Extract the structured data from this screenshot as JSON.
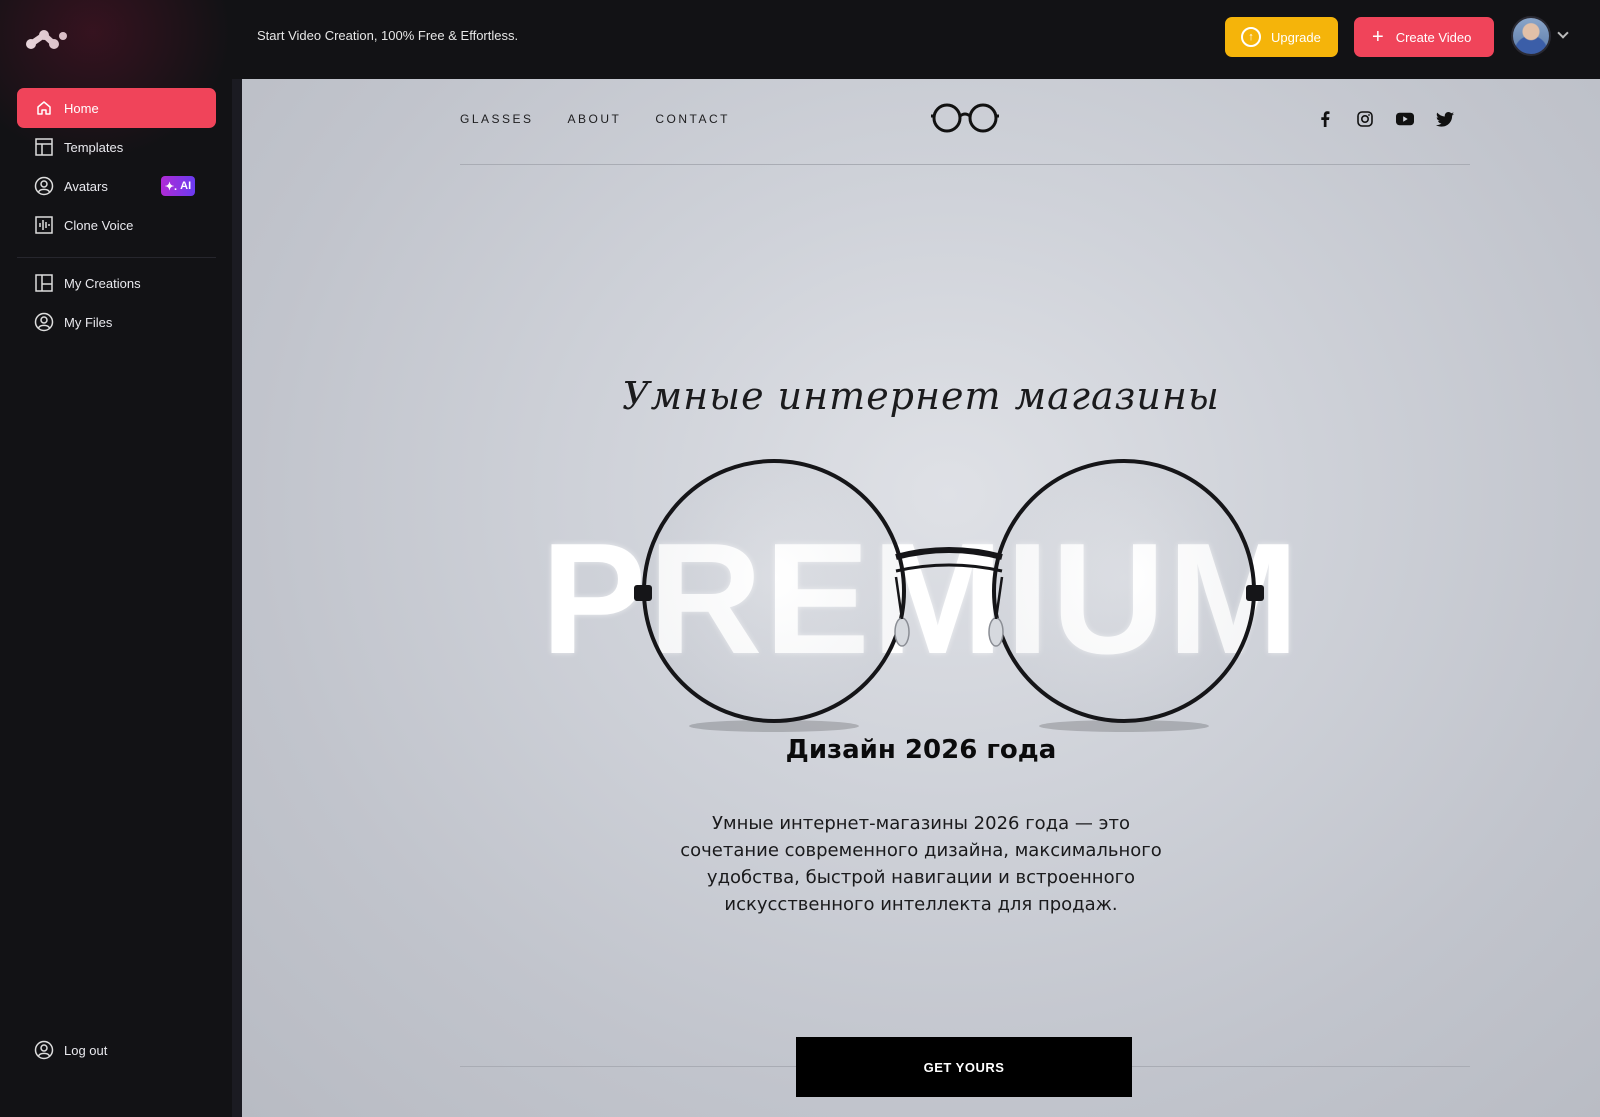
{
  "app": {
    "tagline": "Start Video Creation, 100% Free & Effortless.",
    "upgrade_label": "Upgrade",
    "create_label": "Create Video",
    "accent_color": "#f0445a",
    "upgrade_color": "#f5b40a"
  },
  "sidebar": {
    "items": [
      {
        "label": "Home",
        "icon": "home-icon",
        "active": true
      },
      {
        "label": "Templates",
        "icon": "templates-icon"
      },
      {
        "label": "Avatars",
        "icon": "avatar-icon",
        "badge": "AI"
      },
      {
        "label": "Clone Voice",
        "icon": "voice-icon"
      },
      {
        "label": "My Creations",
        "icon": "creations-icon"
      },
      {
        "label": "My Files",
        "icon": "files-icon"
      }
    ],
    "logout_label": "Log out"
  },
  "site": {
    "nav": [
      "GLASSES",
      "ABOUT",
      "CONTACT"
    ],
    "social": [
      "facebook-icon",
      "instagram-icon",
      "youtube-icon",
      "twitter-icon"
    ],
    "script_title": "Умные интернет магазины",
    "premium_text": "PREMIUM",
    "heading": "Дизайн  2026 года",
    "description": "Умные интернет-магазины 2026 года — это сочетание современного дизайна, максимального удобства, быстрой навигации и встроенного искусственного интеллекта для продаж.",
    "cta_label": "GET YOURS"
  }
}
